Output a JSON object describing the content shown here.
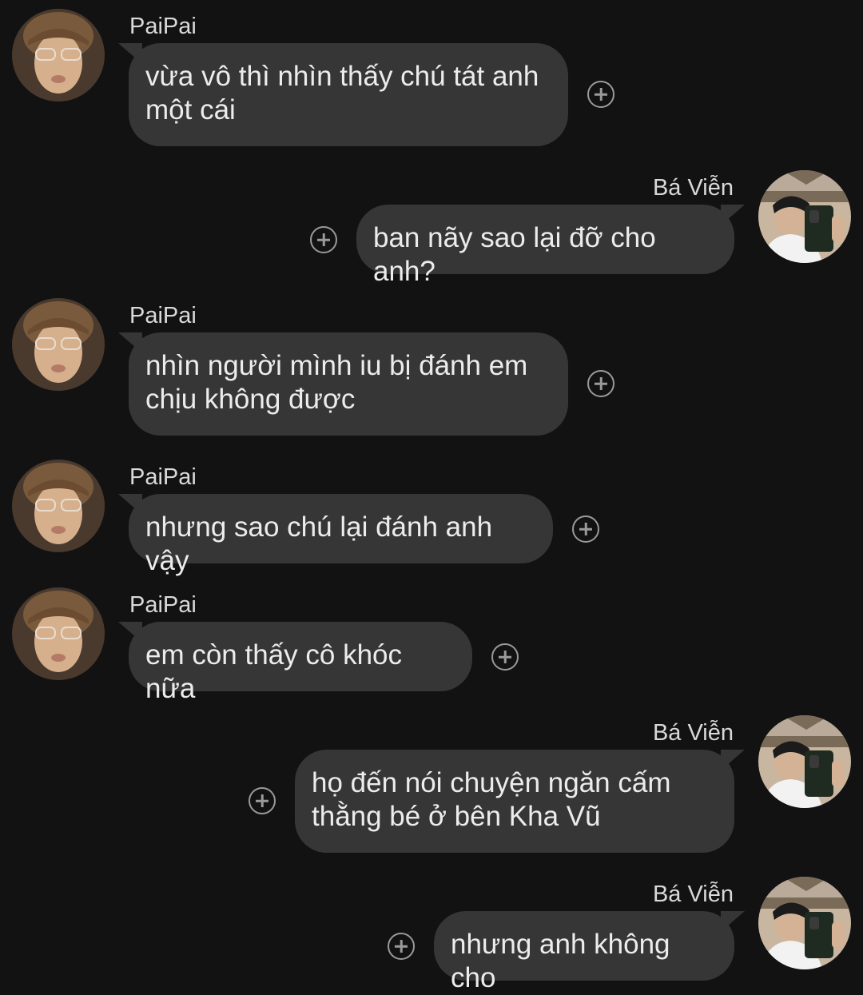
{
  "messages": [
    {
      "sender": "PaiPai",
      "side": "left",
      "text": "vừa vô thì nhìn thấy chú tát anh\nmột cái"
    },
    {
      "sender": "Bá Viễn",
      "side": "right",
      "text": "ban nãy sao lại đỡ cho anh?"
    },
    {
      "sender": "PaiPai",
      "side": "left",
      "text": "nhìn người mình iu bị đánh em\nchịu không được"
    },
    {
      "sender": "PaiPai",
      "side": "left",
      "text": "nhưng sao chú lại đánh anh vậy"
    },
    {
      "sender": "PaiPai",
      "side": "left",
      "text": "em còn thấy cô khóc nữa"
    },
    {
      "sender": "Bá Viễn",
      "side": "right",
      "text": "họ đến nói chuyện ngăn cấm\nthằng bé ở bên Kha Vũ"
    },
    {
      "sender": "Bá Viễn",
      "side": "right",
      "text": "nhưng anh không cho"
    }
  ],
  "icons": {
    "add_reaction": "plus-circle-icon",
    "avatar_left": "avatar-paipai",
    "avatar_right": "avatar-ba-vien"
  },
  "colors": {
    "background": "#121212",
    "bubble": "#363636",
    "text": "#ececec",
    "name": "#d9d9d9",
    "icon": "#9a9a9a"
  }
}
